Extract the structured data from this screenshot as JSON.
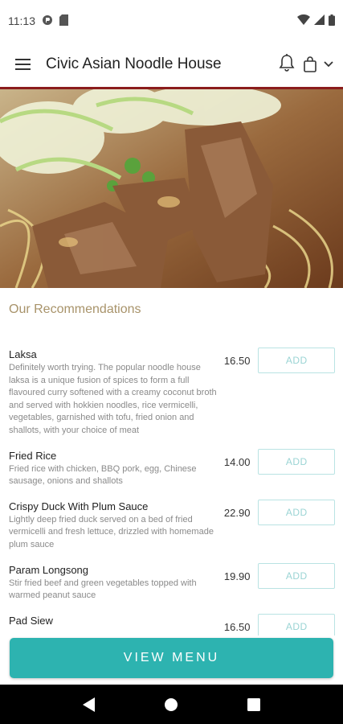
{
  "status_bar": {
    "time": "11:13",
    "icons": [
      "notification-icon",
      "sim-card-icon",
      "wifi-icon",
      "signal-icon",
      "battery-icon"
    ]
  },
  "app_bar": {
    "title": "Civic Asian Noodle House",
    "icons": [
      "hamburger-menu-icon",
      "bell-icon",
      "shopping-bag-icon",
      "chevron-down-icon"
    ]
  },
  "hero": {
    "image": "noodle-soup-photo"
  },
  "recommendations": {
    "heading": "Our Recommendations",
    "items": [
      {
        "name": "Laksa",
        "description": "Definitely worth trying. The popular noodle house laksa is a unique fusion of spices to form a full flavoured curry softened with a creamy coconut broth and served with hokkien noodles, rice vermicelli, vegetables, garnished with tofu, fried onion and shallots, with your choice of meat",
        "price": "16.50",
        "button": "ADD"
      },
      {
        "name": "Fried Rice",
        "description": "Fried rice with chicken, BBQ pork, egg, Chinese sausage, onions and shallots",
        "price": "14.00",
        "button": "ADD"
      },
      {
        "name": "Crispy Duck With Plum Sauce",
        "description": "Lightly deep fried duck served on a bed of fried vermicelli and fresh lettuce, drizzled with homemade plum sauce",
        "price": "22.90",
        "button": "ADD"
      },
      {
        "name": "Param Longsong",
        "description": "Stir fried beef and green vegetables topped with warmed peanut sauce",
        "price": "19.90",
        "button": "ADD"
      },
      {
        "name": "Pad Siew",
        "description": "",
        "price": "16.50",
        "button": "ADD"
      }
    ]
  },
  "footer": {
    "view_menu_label": "VIEW MENU"
  },
  "colors": {
    "accent": "#2db3b0",
    "section_heading": "#a8936a",
    "header_rule": "#8b1c1c",
    "add_button_border": "#b9e3e3"
  }
}
